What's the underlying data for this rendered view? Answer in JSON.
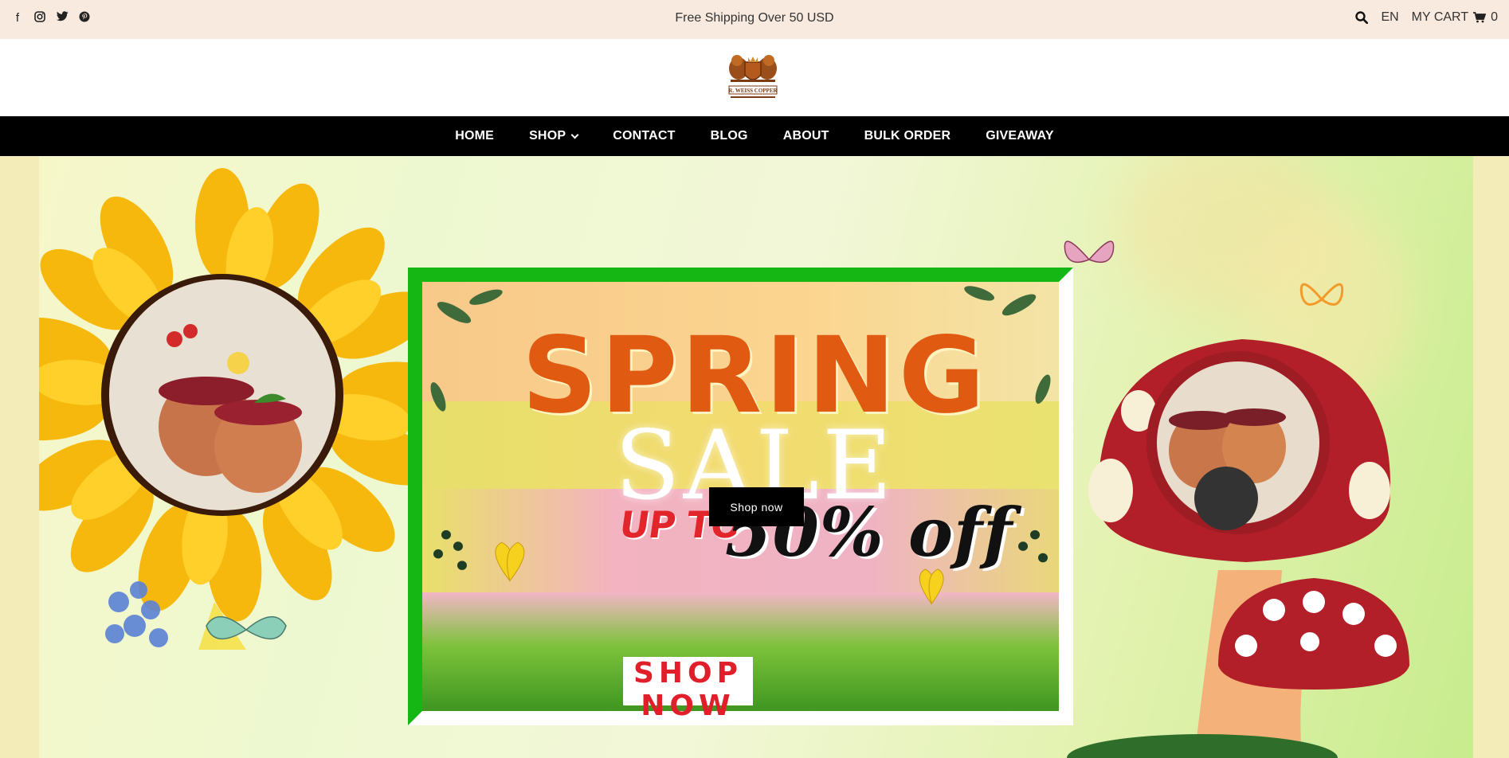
{
  "topbar": {
    "social": [
      "facebook-icon",
      "instagram-icon",
      "twitter-icon",
      "pinterest-icon"
    ],
    "announcement": "Free Shipping Over 50 USD",
    "language": "EN",
    "cart_label": "MY CART",
    "cart_count": "0"
  },
  "brand": {
    "logo_text": "R. WEISS COPPER"
  },
  "nav": {
    "items": [
      {
        "label": "HOME"
      },
      {
        "label": "SHOP"
      },
      {
        "label": "CONTACT"
      },
      {
        "label": "BLOG"
      },
      {
        "label": "ABOUT"
      },
      {
        "label": "BULK ORDER"
      },
      {
        "label": "GIVEAWAY"
      }
    ]
  },
  "hero": {
    "line1": "SPRING",
    "line2": "SALE",
    "upto": "UP TO",
    "discount": "50% off",
    "cta_small": "Shop now",
    "cta_big": "SHOP NOW"
  },
  "colors": {
    "topbar_bg": "#f8eadf",
    "nav_bg": "#000000",
    "spring_orange": "#e05a12",
    "frame_green": "#14b714",
    "sale_red": "#e2242b"
  }
}
